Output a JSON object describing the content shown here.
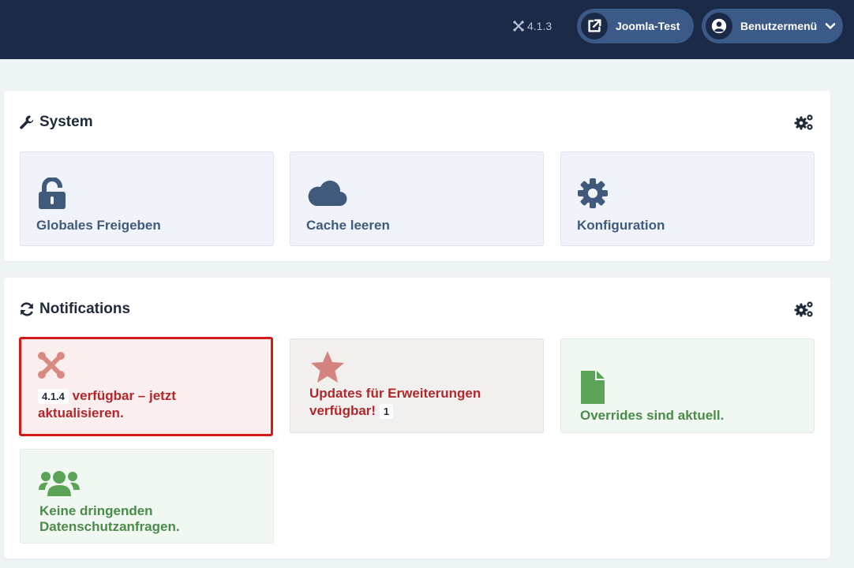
{
  "header": {
    "version": "4.1.3",
    "site_button": "Joomla-Test",
    "user_menu": "Benutzermenü"
  },
  "system": {
    "title": "System",
    "tiles": [
      {
        "label": "Globales Freigeben",
        "icon": "unlock-icon"
      },
      {
        "label": "Cache leeren",
        "icon": "cloud-icon"
      },
      {
        "label": "Konfiguration",
        "icon": "cog-icon"
      }
    ]
  },
  "notifications": {
    "title": "Notifications",
    "update": {
      "version_badge": "4.1.4",
      "text_line1": "verfügbar – jetzt",
      "text_line2": "aktualisieren."
    },
    "extensions": {
      "text_line1": "Updates für Erweiterungen",
      "text_line2": "verfügbar!",
      "count": "1"
    },
    "overrides": {
      "text": "Overrides sind aktuell."
    },
    "privacy": {
      "text_line1": "Keine dringenden",
      "text_line2": "Datenschutzanfragen."
    }
  },
  "colors": {
    "header_bg": "#1b2a47",
    "pill_bg": "#3b5a87",
    "tile_icon": "#405a7c",
    "alert_red": "#d51a1a",
    "text_red": "#b0282b",
    "text_green": "#4a8b4a"
  }
}
